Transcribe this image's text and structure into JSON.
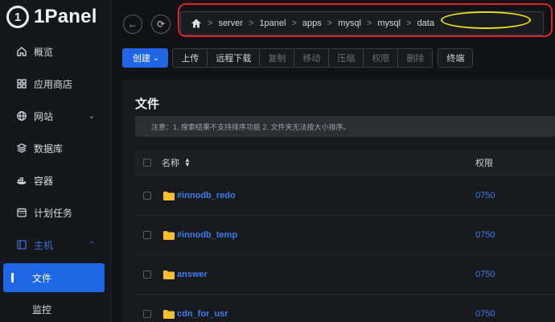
{
  "app": {
    "logo_text": "1Panel",
    "logo_mark": "1"
  },
  "sidebar": {
    "items": [
      {
        "label": "概览",
        "icon": "home-icon"
      },
      {
        "label": "应用商店",
        "icon": "grid-icon"
      },
      {
        "label": "网站",
        "icon": "globe-icon"
      },
      {
        "label": "数据库",
        "icon": "database-icon"
      },
      {
        "label": "容器",
        "icon": "docker-icon"
      },
      {
        "label": "计划任务",
        "icon": "calendar-icon"
      },
      {
        "label": "主机",
        "icon": "host-icon"
      },
      {
        "label": "文件"
      },
      {
        "label": "监控"
      }
    ]
  },
  "breadcrumb": {
    "icon": "home-icon",
    "segments": [
      "server",
      "1panel",
      "apps",
      "mysql",
      "mysql",
      "data"
    ],
    "separator": ">"
  },
  "toolbar": {
    "create_label": "创建",
    "upload_label": "上传",
    "remote_download_label": "远程下载",
    "copy_label": "复制",
    "move_label": "移动",
    "compress_label": "压缩",
    "permission_label": "权限",
    "delete_label": "删除",
    "terminal_label": "终端"
  },
  "files": {
    "title": "文件",
    "notice": "注意：1. 搜索结果不支持排序功能 2. 文件夹无法按大小排序。",
    "columns": {
      "name": "名称",
      "permission": "权限"
    },
    "rows": [
      {
        "name": "#innodb_redo",
        "permission": "0750"
      },
      {
        "name": "#innodb_temp",
        "permission": "0750"
      },
      {
        "name": "answer",
        "permission": "0750"
      },
      {
        "name": "cdn_for_usr",
        "permission": "0750"
      }
    ]
  },
  "colors": {
    "accent": "#2065e3",
    "link": "#3f7ef0",
    "folder": "#f5c02e",
    "annotation_red": "#e0202a",
    "annotation_yellow": "#e8e21c"
  }
}
